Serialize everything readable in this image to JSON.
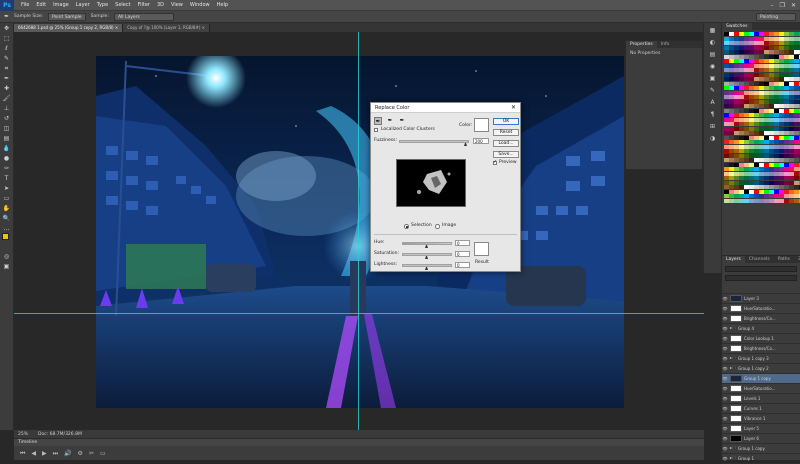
{
  "app": {
    "logo": "Ps"
  },
  "menu": [
    "File",
    "Edit",
    "Image",
    "Layer",
    "Type",
    "Select",
    "Filter",
    "3D",
    "View",
    "Window",
    "Help"
  ],
  "window_controls": [
    "–",
    "❐",
    "✕"
  ],
  "options_bar": {
    "sample_size_label": "Sample Size:",
    "sample_size_value": "Point Sample",
    "sample_label": "Sample:",
    "sample_value": "All Layers",
    "workspace": "Painting"
  },
  "document_tabs": [
    {
      "label": "6642688 1.psd @ 25% (Group 1 copy 2, RGB/8)",
      "active": true
    },
    {
      "label": "Copy of ?@ 100% (Layer 1, RGB/8#)",
      "active": false
    }
  ],
  "status": {
    "zoom": "25%",
    "doc": "Doc: 68.7M/326.8M"
  },
  "timeline": {
    "label": "Timeline",
    "controls": [
      "⏮",
      "◀",
      "▶",
      "⏭",
      "🔊",
      "⚙",
      "✂",
      "▭"
    ]
  },
  "properties_panel": {
    "tabs": [
      "Properties",
      "Info"
    ],
    "content": "No Properties"
  },
  "right_icons": [
    "▦",
    "◐",
    "▤",
    "◉",
    "▣",
    "✎",
    "A",
    "¶",
    "⊞",
    "◑"
  ],
  "swatches": {
    "tabs": [
      "Swatches"
    ],
    "colors": [
      "#000000",
      "#ffffff",
      "#ff0000",
      "#ffff00",
      "#00ff00",
      "#00ffff",
      "#0000ff",
      "#ff00ff",
      "#ed1c24",
      "#f26522",
      "#f7941d",
      "#fff200",
      "#8dc63f",
      "#39b54a",
      "#00a651",
      "#00a99d",
      "#00aeef",
      "#0072bc",
      "#0054a6",
      "#2e3192",
      "#662d91",
      "#92278f",
      "#ec008c",
      "#ed145b",
      "#f69679",
      "#f9ad81",
      "#fdc689",
      "#fff799",
      "#c4df9b",
      "#a3d39c",
      "#82ca9c",
      "#7accc8",
      "#6dcff6",
      "#7da7d9",
      "#8393ca",
      "#8781bd",
      "#a186be",
      "#bd8cbf",
      "#f49ac1",
      "#f5989d",
      "#9e0b0f",
      "#a0410d",
      "#a36209",
      "#aba000",
      "#598527",
      "#1a7b30",
      "#007236",
      "#00746b",
      "#0076a3",
      "#004b80",
      "#003471",
      "#1b1464",
      "#440e62",
      "#630460",
      "#9e005d",
      "#9e0039",
      "#790000",
      "#7b2e00",
      "#7d4900",
      "#827b00",
      "#406618",
      "#005e20",
      "#005826",
      "#005952",
      "#005b7f",
      "#003663",
      "#002157",
      "#0d004c",
      "#32004b",
      "#4b0049",
      "#7b0046",
      "#7a0026",
      "#c69c6d",
      "#a67c52",
      "#8c6239",
      "#754c24",
      "#603913",
      "#3c2415",
      "#ffffff",
      "#ebebeb",
      "#d7d7d7",
      "#c2c2c2",
      "#acacac",
      "#959595",
      "#7f7f7f",
      "#686868",
      "#535353",
      "#3e3e3e",
      "#2a2a2a",
      "#161616",
      "#000000",
      "#ff8080",
      "#ffbf80",
      "#ffff80"
    ]
  },
  "layers_panel": {
    "tabs": [
      "Layers",
      "Channels",
      "Paths",
      "3D"
    ],
    "layers": [
      {
        "name": "Layer 3",
        "thumb": "dark",
        "selected": false
      },
      {
        "name": "Hue/Saturatio...",
        "thumb": "white",
        "selected": false
      },
      {
        "name": "Brightness/Co...",
        "thumb": "white",
        "selected": false
      },
      {
        "name": "Group 4",
        "thumb": "none",
        "selected": false
      },
      {
        "name": "Color Lookup 1",
        "thumb": "white",
        "selected": false
      },
      {
        "name": "Brightness/Co...",
        "thumb": "white",
        "selected": false
      },
      {
        "name": "Group 1 copy 3",
        "thumb": "none",
        "selected": false
      },
      {
        "name": "Group 1 copy 2",
        "thumb": "none",
        "selected": false
      },
      {
        "name": "Group 1 copy",
        "thumb": "dark",
        "selected": true
      },
      {
        "name": "Hue/Saturatio...",
        "thumb": "white",
        "selected": false
      },
      {
        "name": "Levels 1",
        "thumb": "white",
        "selected": false
      },
      {
        "name": "Curves 1",
        "thumb": "white",
        "selected": false
      },
      {
        "name": "Vibrance 1",
        "thumb": "white",
        "selected": false
      },
      {
        "name": "Layer 5",
        "thumb": "white",
        "selected": false
      },
      {
        "name": "Layer 6",
        "thumb": "blk",
        "selected": false
      },
      {
        "name": "Group 1 copy",
        "thumb": "none",
        "selected": false
      },
      {
        "name": "Group 1",
        "thumb": "none",
        "selected": false
      }
    ]
  },
  "dialog": {
    "title": "Replace Color",
    "localized_label": "Localized Color Clusters",
    "color_label": "Color:",
    "fuzziness_label": "Fuzziness:",
    "fuzziness_value": "200",
    "buttons": {
      "ok": "OK",
      "reset": "Reset",
      "load": "Load...",
      "save": "Save..."
    },
    "preview_label": "Preview",
    "selection_label": "Selection",
    "image_label": "Image",
    "hue_label": "Hue:",
    "hue_value": "0",
    "saturation_label": "Saturation:",
    "saturation_value": "0",
    "lightness_label": "Lightness:",
    "lightness_value": "0",
    "result_label": "Result"
  }
}
